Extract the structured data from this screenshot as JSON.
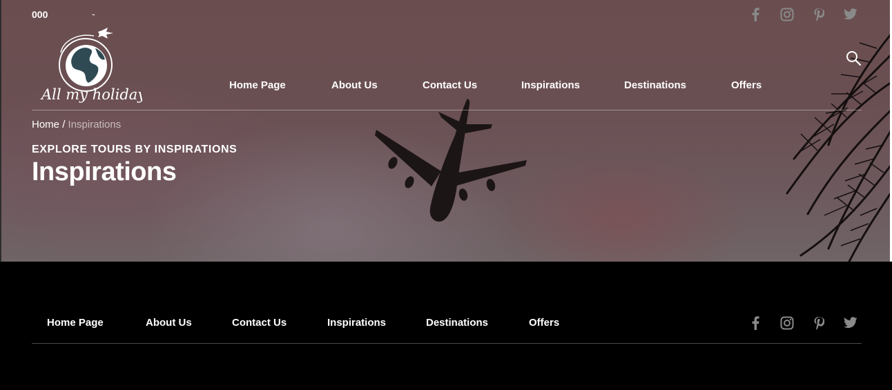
{
  "topbar": {
    "phone": "000",
    "separator": "-"
  },
  "logo": {
    "text": "All my holidays"
  },
  "nav": {
    "items": [
      {
        "label": "Home Page"
      },
      {
        "label": "About Us"
      },
      {
        "label": "Contact Us"
      },
      {
        "label": "Inspirations"
      },
      {
        "label": "Destinations"
      },
      {
        "label": "Offers"
      }
    ]
  },
  "social": {
    "icons": [
      "facebook-icon",
      "instagram-icon",
      "pinterest-icon",
      "twitter-icon"
    ],
    "color": "#8a8a8a"
  },
  "breadcrumb": {
    "home": "Home",
    "separator": "/",
    "current": "Inspirations"
  },
  "hero": {
    "eyebrow": "EXPLORE TOURS BY INSPIRATIONS",
    "title": "Inspirations"
  },
  "footer": {
    "nav": [
      {
        "label": "Home Page"
      },
      {
        "label": "About Us"
      },
      {
        "label": "Contact Us"
      },
      {
        "label": "Inspirations"
      },
      {
        "label": "Destinations"
      },
      {
        "label": "Offers"
      }
    ]
  },
  "colors": {
    "hero_overlay": "#6a4f52",
    "footer_bg": "#000000",
    "breadcrumb_current": "#c9bcbd"
  }
}
